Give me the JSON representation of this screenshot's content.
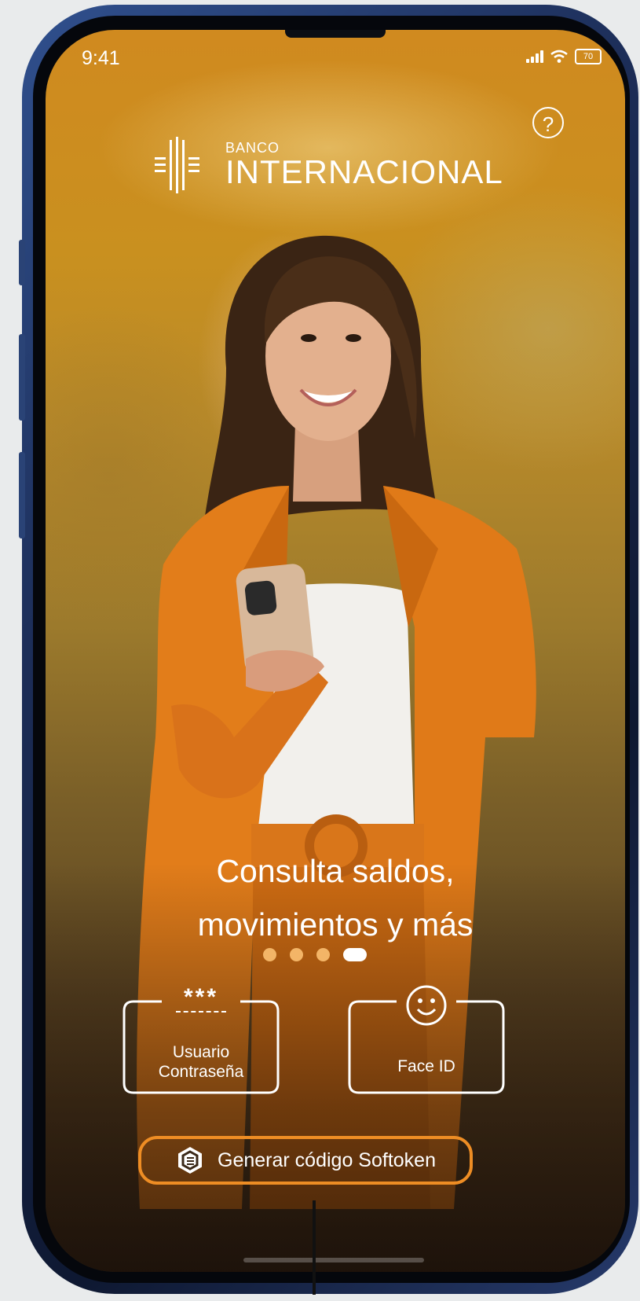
{
  "status_bar": {
    "time": "9:41",
    "battery": "70",
    "signal_icon": "cellular-signal-icon",
    "wifi_icon": "wifi-icon"
  },
  "header": {
    "help_icon": "question-circle-icon",
    "help_glyph": "?",
    "logo_small": "BANCO",
    "logo_main": "INTERNACIONAL"
  },
  "carousel": {
    "headline_line1": "Consulta saldos,",
    "headline_line2": "movimientos y más",
    "page_count": 4,
    "active_page": 4
  },
  "login_options": {
    "user_password": {
      "stars": "***",
      "line1": "Usuario",
      "line2": "Contraseña"
    },
    "face_id": {
      "label": "Face ID",
      "icon": "smiley-face-icon"
    }
  },
  "softoken": {
    "label": "Generar código Softoken",
    "icon": "softoken-hexagon-icon"
  },
  "colors": {
    "accent_orange": "#ee8d24",
    "dot_inactive": "#f3b567",
    "dot_active": "#ffffff",
    "frame_blue": "#1c2d57"
  }
}
